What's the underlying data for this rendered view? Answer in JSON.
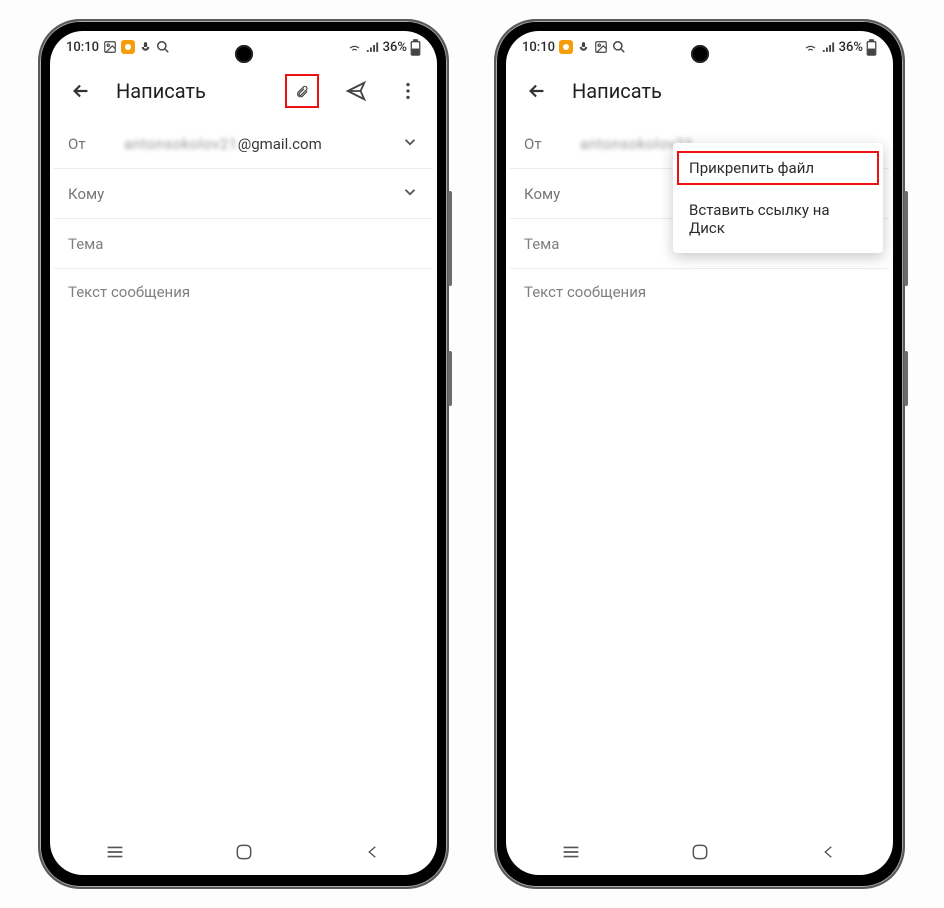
{
  "status": {
    "time": "10:10",
    "battery_text": "36%"
  },
  "left_phone": {
    "appbar": {
      "title": "Написать"
    },
    "from_label": "От",
    "from_email_blur": "antonsokolov21",
    "from_email_tail": "@gmail.com",
    "to_label": "Кому",
    "subject_placeholder": "Тема",
    "body_placeholder": "Текст сообщения"
  },
  "right_phone": {
    "appbar": {
      "title": "Написать"
    },
    "from_label": "От",
    "from_email_blur": "antonsokolov21",
    "to_label": "Кому",
    "subject_placeholder": "Тема",
    "body_placeholder": "Текст сообщения",
    "menu": {
      "attach_file": "Прикрепить файл",
      "insert_drive_link": "Вставить ссылку на Диск"
    }
  }
}
